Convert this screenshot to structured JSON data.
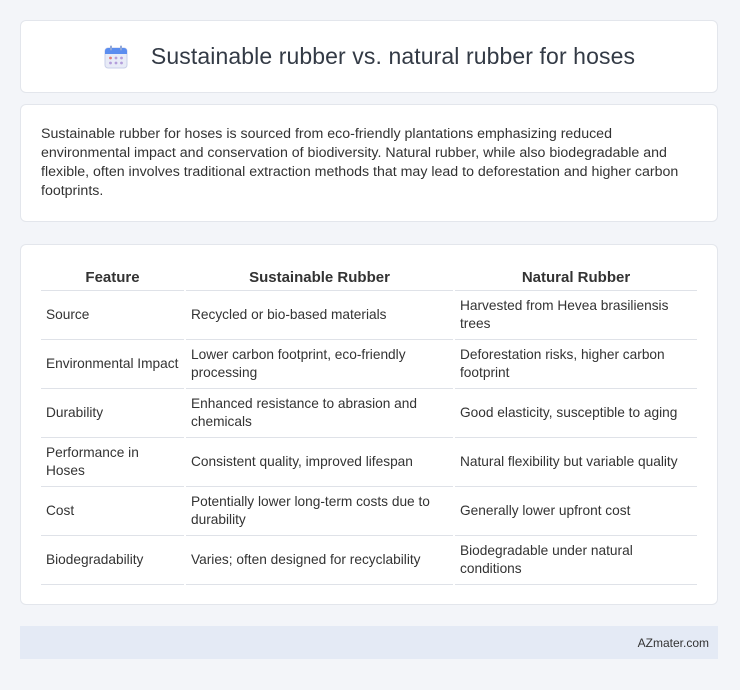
{
  "header": {
    "title": "Sustainable rubber vs. natural rubber for hoses",
    "icon": "calendar-icon"
  },
  "intro": {
    "text": "Sustainable rubber for hoses is sourced from eco-friendly plantations emphasizing reduced environmental impact and conservation of biodiversity. Natural rubber, while also biodegradable and flexible, often involves traditional extraction methods that may lead to deforestation and higher carbon footprints."
  },
  "table": {
    "headers": [
      "Feature",
      "Sustainable Rubber",
      "Natural Rubber"
    ],
    "rows": [
      [
        "Source",
        "Recycled or bio-based materials",
        "Harvested from Hevea brasiliensis trees"
      ],
      [
        "Environmental Impact",
        "Lower carbon footprint, eco-friendly processing",
        "Deforestation risks, higher carbon footprint"
      ],
      [
        "Durability",
        "Enhanced resistance to abrasion and chemicals",
        "Good elasticity, susceptible to aging"
      ],
      [
        "Performance in Hoses",
        "Consistent quality, improved lifespan",
        "Natural flexibility but variable quality"
      ],
      [
        "Cost",
        "Potentially lower long-term costs due to durability",
        "Generally lower upfront cost"
      ],
      [
        "Biodegradability",
        "Varies; often designed for recyclability",
        "Biodegradable under natural conditions"
      ]
    ]
  },
  "footer": {
    "brand": "AZmater.com"
  }
}
